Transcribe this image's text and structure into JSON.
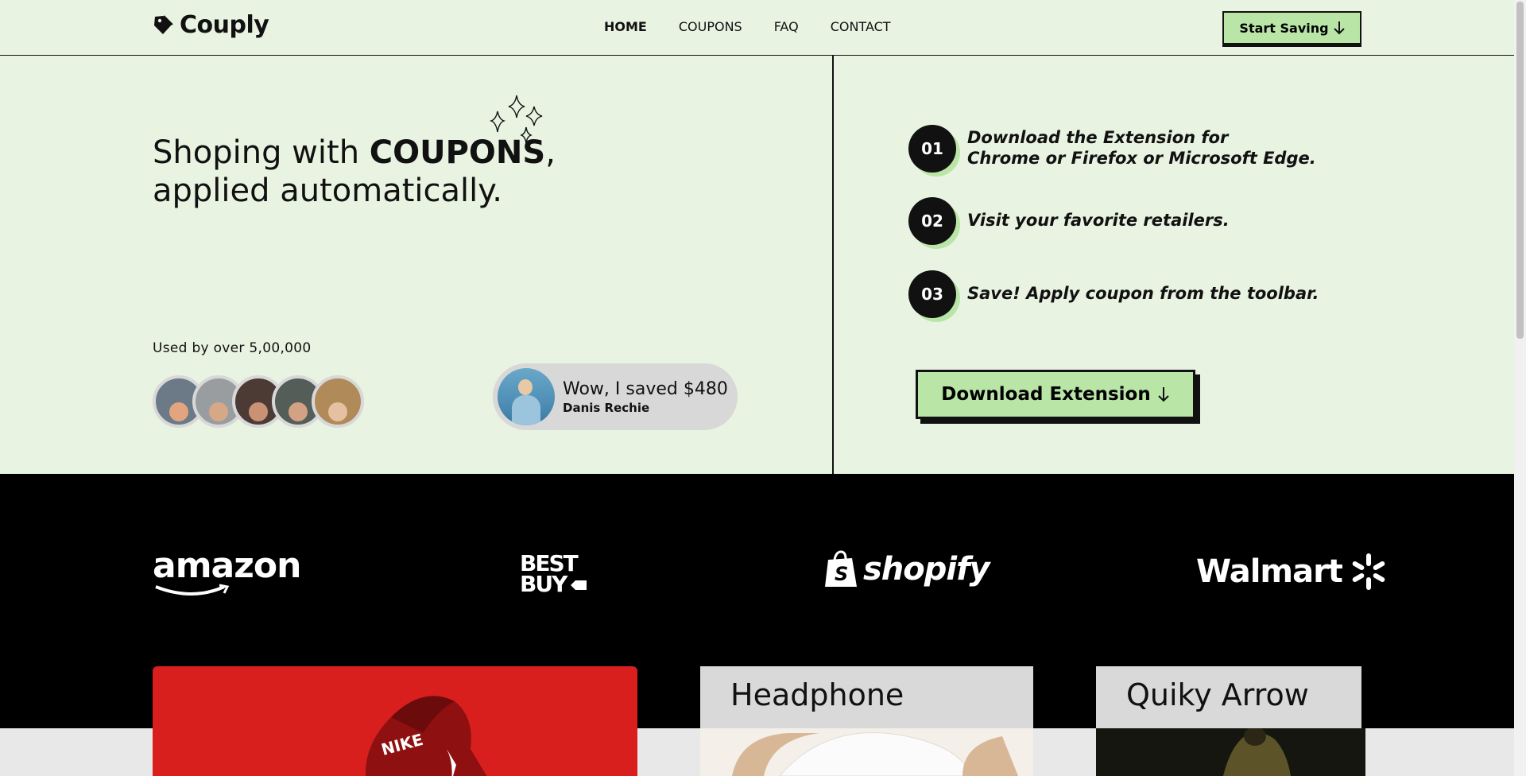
{
  "header": {
    "logo_text": "Couply",
    "nav": [
      "HOME",
      "COUPONS",
      "FAQ",
      "CONTACT"
    ],
    "cta": "Start Saving"
  },
  "hero": {
    "title_prefix": "Shoping with ",
    "title_bold": "COUPONS",
    "title_comma": ",",
    "title_line2": "applied automatically.",
    "used_by": "Used by over 5,00,000",
    "testimonial_quote": "Wow, I saved $480",
    "testimonial_name": "Danis Rechie"
  },
  "steps": [
    {
      "num": "01",
      "line1": "Download the Extension for",
      "line2": "Chrome or Firefox or Microsoft Edge."
    },
    {
      "num": "02",
      "line1": "Visit your favorite retailers.",
      "line2": ""
    },
    {
      "num": "03",
      "line1": "Save! Apply coupon from the toolbar.",
      "line2": ""
    }
  ],
  "download_button": "Download Extension",
  "brands": {
    "amazon": "amazon",
    "bestbuy_line1": "BEST",
    "bestbuy_line2": "BUY",
    "shopify": "shopify",
    "walmart": "Walmart"
  },
  "cards": {
    "nike_logo": "NIKE",
    "headphone": "Headphone",
    "quiky_arrow": "Quiky Arrow"
  },
  "colors": {
    "background": "#e8f3e1",
    "accent": "#b9e6a7",
    "dark": "#111111",
    "brand_band": "#000000",
    "nike_card": "#d91e1e"
  }
}
